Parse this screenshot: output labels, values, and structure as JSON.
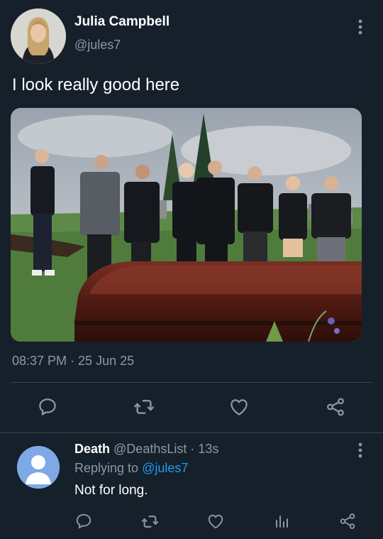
{
  "tweet": {
    "display_name": "Julia Campbell",
    "handle": "@jules7",
    "text": "I look really good here",
    "timestamp": "08:37 PM · 25 Jun 25",
    "photo_icon": "funeral-photo"
  },
  "actions": {
    "reply_icon": "reply-icon",
    "retweet_icon": "retweet-icon",
    "like_icon": "heart-icon",
    "share_icon": "share-icon"
  },
  "reply": {
    "display_name": "Death",
    "handle": "@DeathsList",
    "separator": "·",
    "age": "13s",
    "replying_prefix": "Replying to",
    "replying_to": "@jules7",
    "text": "Not for long.",
    "actions": [
      "reply-icon",
      "retweet-icon",
      "heart-icon",
      "analytics-icon",
      "share-icon"
    ]
  },
  "colors": {
    "background": "#15202b",
    "secondary_text": "#8b98a5",
    "link": "#1d9bf0",
    "divider": "#38444d"
  }
}
